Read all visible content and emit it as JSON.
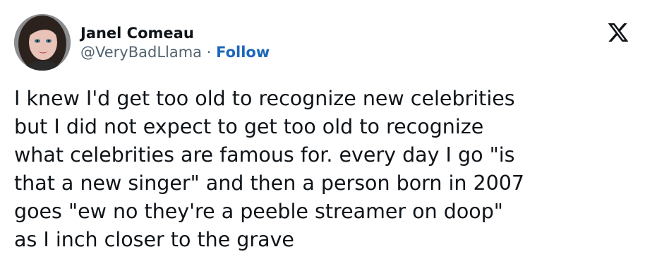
{
  "author": {
    "display_name": "Janel Comeau",
    "handle": "@VeryBadLlama",
    "separator": " · ",
    "follow_label": "Follow",
    "avatar_icon": "profile-photo"
  },
  "platform_icon": "x-logo-icon",
  "tweet": {
    "lines": [
      "I knew I'd get too old to recognize new celebrities",
      "but I did not expect to get too old to recognize",
      "what celebrities are famous for. every day I go \"is",
      "that a new singer\" and then a person born in 2007",
      "goes \"ew no they're a peeble streamer on doop\"",
      "as I inch closer to the grave"
    ]
  },
  "colors": {
    "text": "#0f1419",
    "secondary": "#536471",
    "link": "#1d68b9",
    "background": "#ffffff"
  }
}
